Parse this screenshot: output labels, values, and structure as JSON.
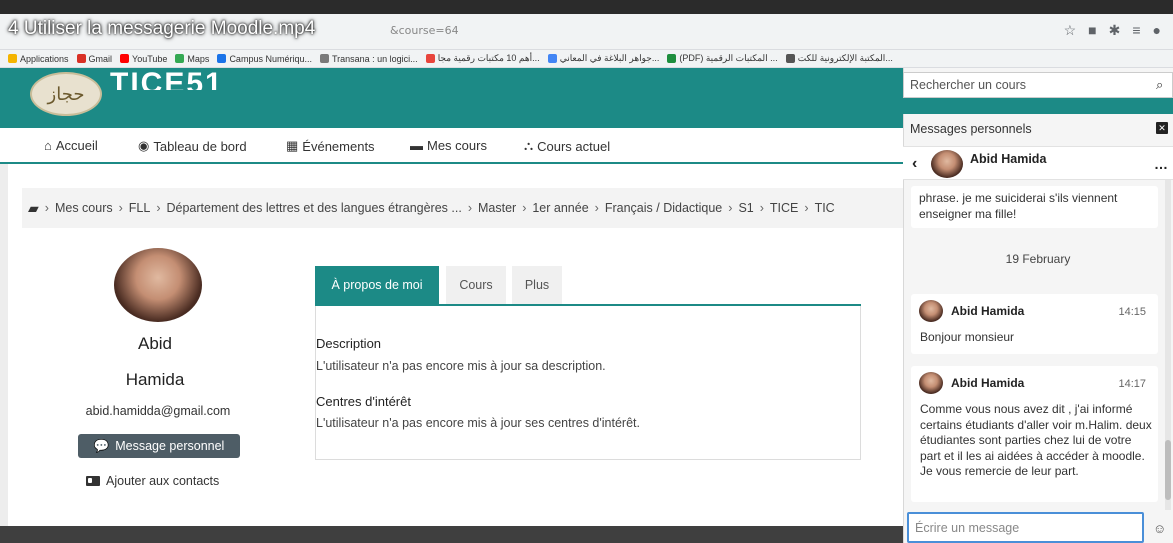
{
  "video": {
    "title": "4 Utiliser la messagerie Moodle.mp4"
  },
  "browser": {
    "url_fragment": "&course=64",
    "bookmarks": [
      {
        "label": "Applications",
        "color": "#f4b400"
      },
      {
        "label": "Gmail",
        "color": "#d93025"
      },
      {
        "label": "YouTube",
        "color": "#ff0000"
      },
      {
        "label": "Maps",
        "color": "#34a853"
      },
      {
        "label": "Campus Numériqu...",
        "color": "#1a73e8"
      },
      {
        "label": "Transana : un logici...",
        "color": "#7a7a7a"
      },
      {
        "label": "أهم 10 مكتبات رقمية مجا...",
        "color": "#e8453c"
      },
      {
        "label": "جواهر البلاغة في المعاني...",
        "color": "#4285f4"
      },
      {
        "label": "(PDF) المكتبات الرقمية ...",
        "color": "#1e8e3e"
      },
      {
        "label": "المكتبة الإلكترونية للكت...",
        "color": "#555555"
      }
    ]
  },
  "site": {
    "name": "TICE51",
    "logo_text": "حجاز",
    "accent": "#1c8a86"
  },
  "nav": {
    "home": "Accueil",
    "dashboard": "Tableau de bord",
    "events": "Événements",
    "my_courses": "Mes cours",
    "current_course": "Cours actuel"
  },
  "breadcrumb": [
    "Mes cours",
    "FLL",
    "Département des lettres et des langues étrangères ...",
    "Master",
    "1er année",
    "Français / Didactique",
    "S1",
    "TICE",
    "TIC"
  ],
  "profile": {
    "first_name": "Abid",
    "last_name": "Hamida",
    "email": "abid.hamidda@gmail.com",
    "message_button": "Message personnel",
    "add_contact": "Ajouter aux contacts"
  },
  "tabs": {
    "about": "À propos de moi",
    "courses": "Cours",
    "more": "Plus"
  },
  "about": {
    "description_heading": "Description",
    "description_text": "L'utilisateur n'a pas encore mis à jour sa description.",
    "interests_heading": "Centres d'intérêt",
    "interests_text": "L'utilisateur n'a pas encore mis à jour ses centres d'intérêt."
  },
  "drawer": {
    "search_placeholder": "Rechercher un cours",
    "title": "Messages personnels",
    "contact_name": "Abid Hamida",
    "partial_message": "phrase. je me suiciderai s'ils viennent enseigner ma fille!",
    "date_separator": "19 February",
    "messages": [
      {
        "sender": "Abid Hamida",
        "time": "14:15",
        "text": "Bonjour monsieur"
      },
      {
        "sender": "Abid Hamida",
        "time": "14:17",
        "text": "Comme vous nous avez dit , j'ai informé certains étudiants d'aller voir m.Halim. deux étudiantes sont parties chez lui de votre part et il les ai aidées à accéder à moodle. Je vous remercie de leur part."
      }
    ],
    "compose_placeholder": "Écrire un message"
  }
}
